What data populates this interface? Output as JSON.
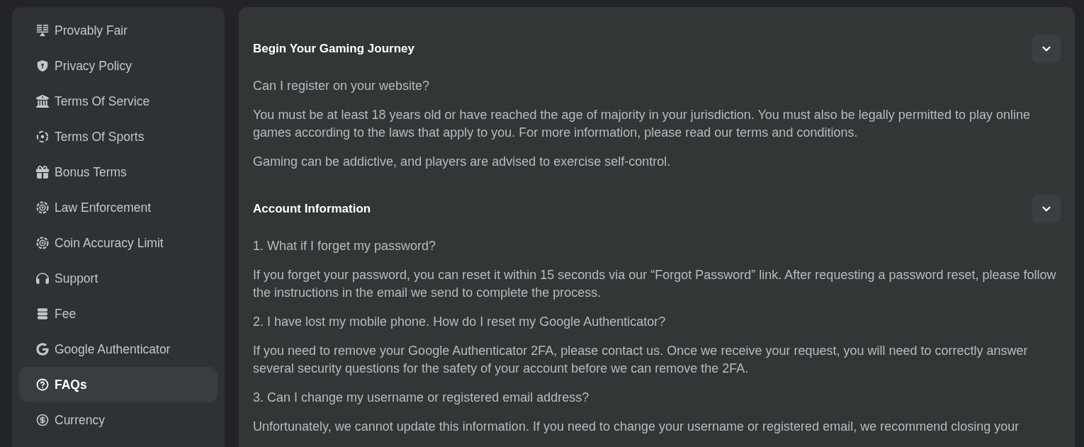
{
  "sidebar": {
    "items": [
      {
        "label": "Provably Fair",
        "selected": false
      },
      {
        "label": "Privacy Policy",
        "selected": false
      },
      {
        "label": "Terms Of Service",
        "selected": false
      },
      {
        "label": "Terms Of Sports",
        "selected": false
      },
      {
        "label": "Bonus Terms",
        "selected": false
      },
      {
        "label": "Law Enforcement",
        "selected": false
      },
      {
        "label": "Coin Accuracy Limit",
        "selected": false
      },
      {
        "label": "Support",
        "selected": false
      },
      {
        "label": "Fee",
        "selected": false
      },
      {
        "label": "Google Authenticator",
        "selected": false
      },
      {
        "label": "FAQs",
        "selected": true
      },
      {
        "label": "Currency",
        "selected": false
      }
    ]
  },
  "sections": [
    {
      "title": "Begin Your Gaming Journey",
      "expanded": true,
      "paragraphs": [
        "Can I register on your website?",
        "You must be at least 18 years old or have reached the age of majority in your jurisdiction. You must also be legally permitted to play online games according to the laws that apply to you. For more information, please read our terms and conditions.",
        "Gaming can be addictive, and players are advised to exercise self-control."
      ]
    },
    {
      "title": "Account Information",
      "expanded": true,
      "paragraphs": [
        "1. What if I forget my password?",
        "If you forget your password, you can reset it within 15 seconds via our “Forgot Password” link. After requesting a password reset, please follow the instructions in the email we send to complete the process.",
        "2. I have lost my mobile phone. How do I reset my Google Authenticator?",
        "If you need to remove your Google Authenticator 2FA, please contact us. Once we receive your request, you will need to correctly answer several security questions for the safety of your account before we can remove the 2FA.",
        "3. Can I change my username or registered email address?",
        "Unfortunately, we cannot update this information. If you need to change your username or registered email, we recommend closing your"
      ]
    }
  ]
}
